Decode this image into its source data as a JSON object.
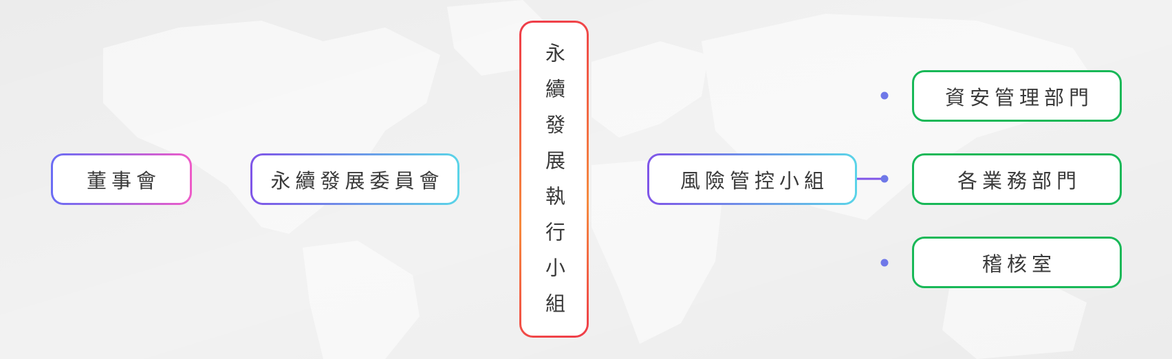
{
  "diagram": {
    "nodes": {
      "board": "董事會",
      "committee": "永續發展委員會",
      "exec_team": "永續發展執行小組",
      "risk_team": "風險管控小組",
      "infosec": "資安管理部門",
      "business": "各業務部門",
      "audit": "稽核室"
    },
    "colors": {
      "background": "#ececec",
      "green_border": "#18b857",
      "purple": "#7f55e8",
      "cyan": "#5ad4e8",
      "red": "#ef3b49",
      "orange": "#f68a3e",
      "pink": "#ee5bc8",
      "blue": "#6a6cf4",
      "dot": "#5f7fe8"
    }
  }
}
